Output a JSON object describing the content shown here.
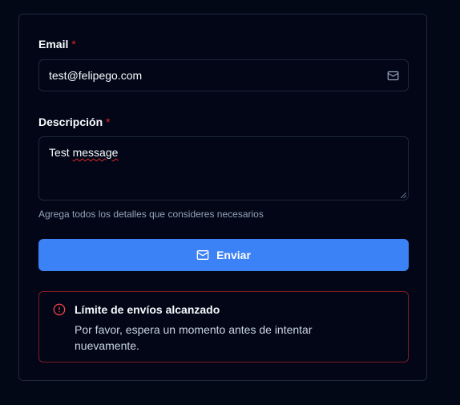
{
  "form": {
    "email": {
      "label": "Email",
      "required_mark": "*",
      "value": "test@felipego.com",
      "icon": "mail-icon"
    },
    "description": {
      "label": "Descripción",
      "required_mark": "*",
      "value": "Test message",
      "value_first_word": "Test",
      "value_misspelled_word": "message",
      "helper": "Agrega todos los detalles que consideres necesarios"
    },
    "submit": {
      "label": "Enviar",
      "icon": "mail-icon"
    }
  },
  "alert": {
    "title": "Límite de envíos alcanzado",
    "message": "Por favor, espera un momento antes de intentar nuevamente.",
    "icon": "alert-circle-icon"
  },
  "colors": {
    "background": "#030817",
    "card": "#020617",
    "border": "#1e293b",
    "primary": "#3b82f6",
    "required": "#dc2626",
    "alert_border": "#7f1d1d",
    "alert_icon": "#ef4444"
  }
}
